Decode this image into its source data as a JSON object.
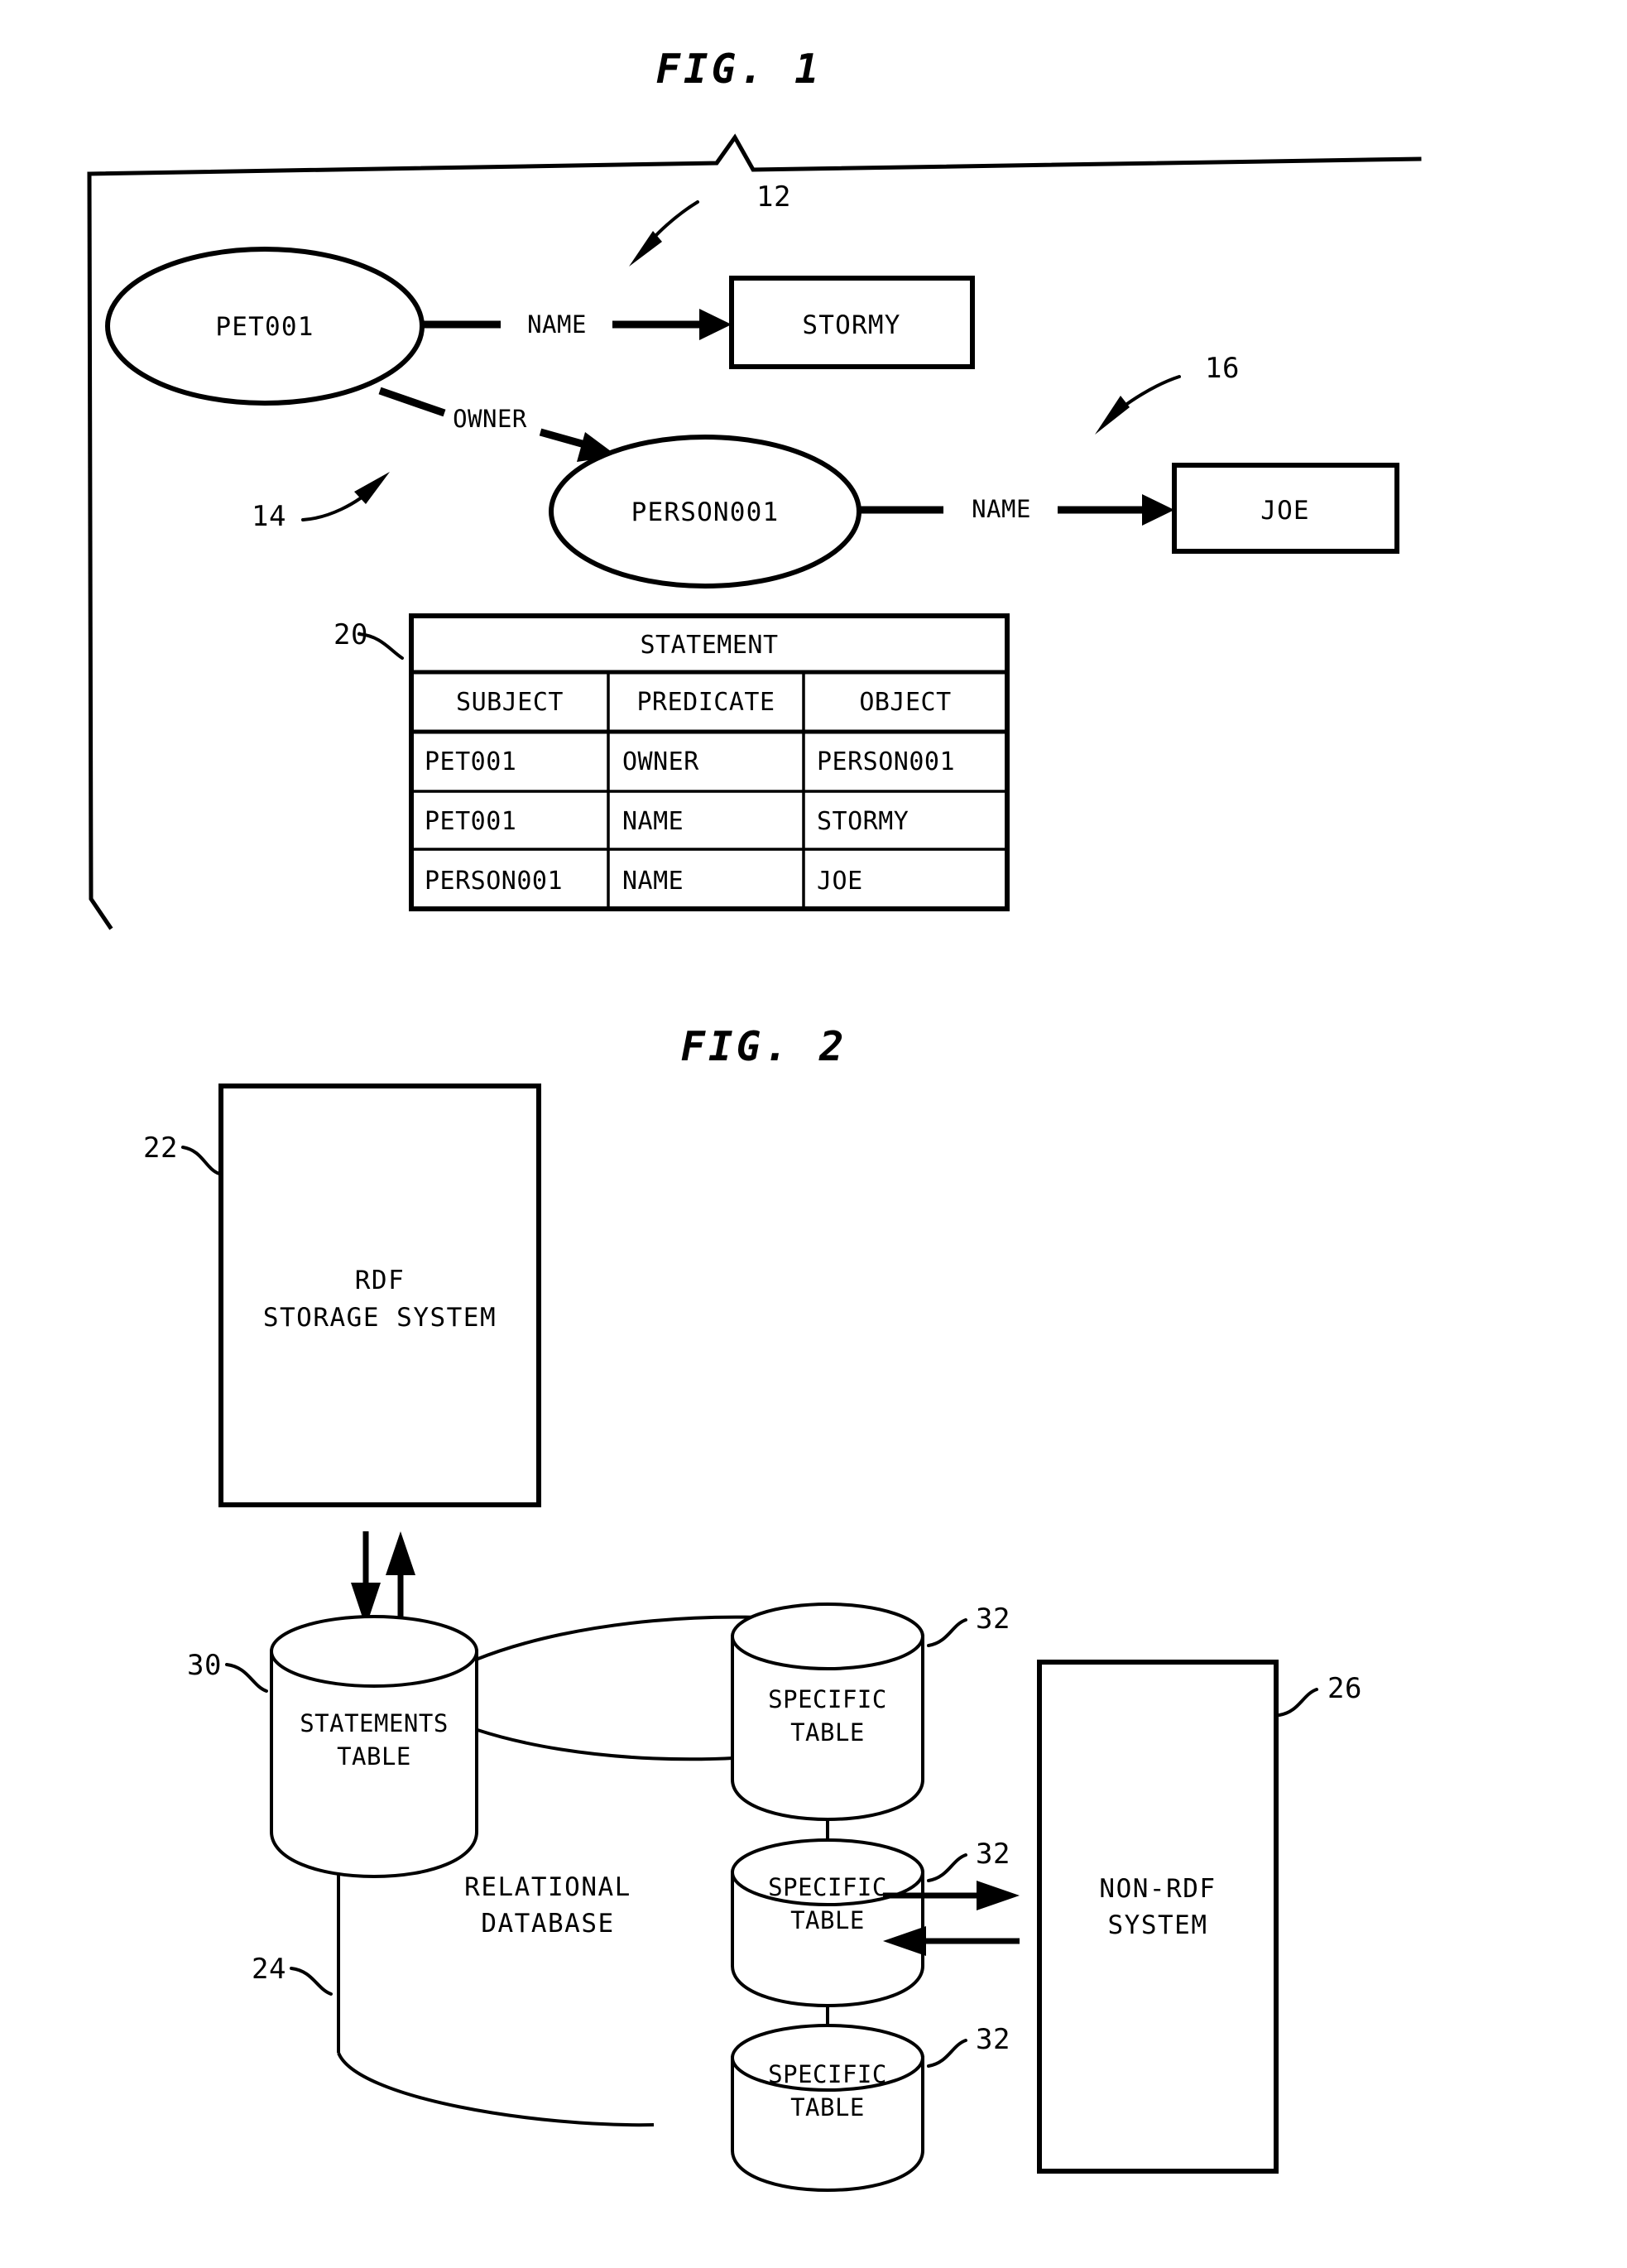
{
  "figures": [
    {
      "id": "fig1",
      "title": "FIG. 1",
      "graph": {
        "nodes": [
          {
            "id": "pet",
            "label": "PET001",
            "shape": "ellipse"
          },
          {
            "id": "person",
            "label": "PERSON001",
            "shape": "ellipse"
          },
          {
            "id": "stormy",
            "label": "STORMY",
            "shape": "rect"
          },
          {
            "id": "joe",
            "label": "JOE",
            "shape": "rect"
          }
        ],
        "edges": [
          {
            "from": "pet",
            "to": "stormy",
            "label": "NAME"
          },
          {
            "from": "pet",
            "to": "person",
            "label": "OWNER"
          },
          {
            "from": "person",
            "to": "joe",
            "label": "NAME"
          }
        ]
      },
      "callouts": [
        {
          "ref": "12",
          "target": "stormy-literal-node",
          "style": "curved-arrow"
        },
        {
          "ref": "14",
          "target": "owner-predicate",
          "style": "curved-arrow"
        },
        {
          "ref": "16",
          "target": "joe-literal-node",
          "style": "curved-arrow"
        },
        {
          "ref": "20",
          "target": "statement-table",
          "style": "leader-line"
        }
      ],
      "table": {
        "caption": "STATEMENT",
        "columns": [
          "SUBJECT",
          "PREDICATE",
          "OBJECT"
        ],
        "rows": [
          [
            "PET001",
            "OWNER",
            "PERSON001"
          ],
          [
            "PET001",
            "NAME",
            "STORMY"
          ],
          [
            "PERSON001",
            "NAME",
            "JOE"
          ]
        ]
      }
    },
    {
      "id": "fig2",
      "title": "FIG. 2",
      "blocks": [
        {
          "id": "rdf",
          "lines": [
            "RDF",
            "STORAGE SYSTEM"
          ],
          "ref": "22"
        },
        {
          "id": "nonrdf",
          "lines": [
            "NON-RDF",
            "SYSTEM"
          ],
          "ref": "26"
        }
      ],
      "database": {
        "ref": "24",
        "lines": [
          "RELATIONAL",
          "DATABASE"
        ],
        "cylinders": [
          {
            "id": "statements",
            "lines": [
              "STATEMENTS",
              "TABLE"
            ],
            "ref": "30"
          },
          {
            "id": "specific1",
            "lines": [
              "SPECIFIC",
              "TABLE"
            ],
            "ref": "32"
          },
          {
            "id": "specific2",
            "lines": [
              "SPECIFIC",
              "TABLE"
            ],
            "ref": "32"
          },
          {
            "id": "specific3",
            "lines": [
              "SPECIFIC",
              "TABLE"
            ],
            "ref": "32"
          }
        ]
      },
      "connectors": [
        {
          "id": "rdf-to-db-down",
          "direction": "down"
        },
        {
          "id": "rdf-to-db-up",
          "direction": "up"
        },
        {
          "id": "db-to-nonrdf-right",
          "direction": "right"
        },
        {
          "id": "nonrdf-to-db-left",
          "direction": "left"
        }
      ]
    }
  ],
  "colors": {
    "ink": "#000000",
    "paper": "#ffffff"
  }
}
